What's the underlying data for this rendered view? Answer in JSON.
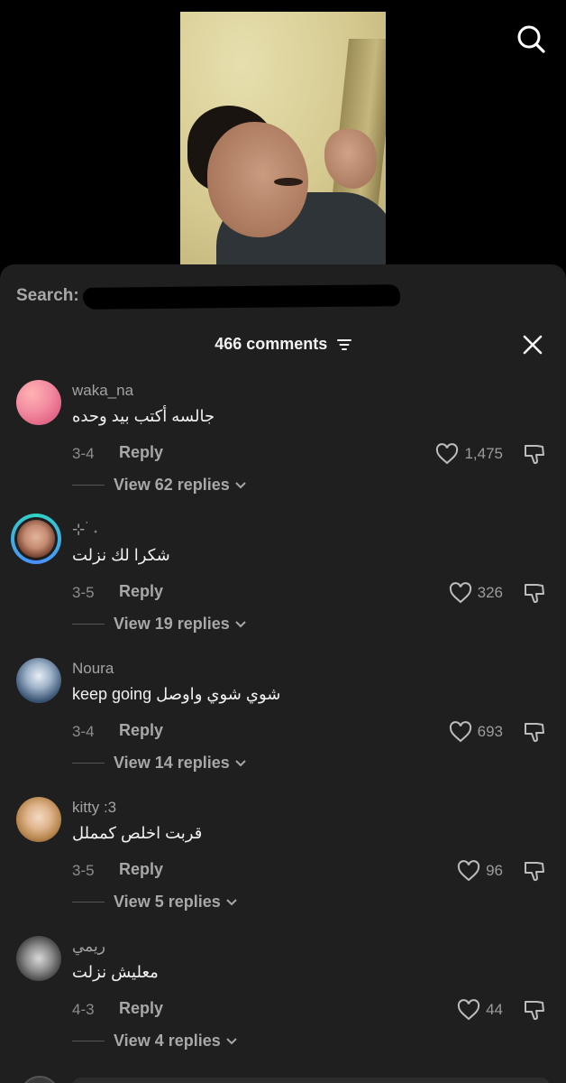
{
  "search": {
    "label": "Search:",
    "icon": "search-icon"
  },
  "comments_panel": {
    "count_label": "466 comments",
    "filter_icon": "filter-icon",
    "close_icon": "close-icon"
  },
  "comments": [
    {
      "username": "waka_na",
      "text": "جالسه أكتب بيد وحده",
      "date": "3-4",
      "reply_label": "Reply",
      "likes": "1,475",
      "replies_label": "View 62 replies",
      "avatar_style": "gradient-pink"
    },
    {
      "username": "⊹ ࣪ ˖",
      "text": "شكرا لك نزلت",
      "date": "3-5",
      "reply_label": "Reply",
      "likes": "326",
      "replies_label": "View 19 replies",
      "avatar_style": "story-ring"
    },
    {
      "username": "Noura",
      "text": "keep going شوي شوي واوصل",
      "date": "3-4",
      "reply_label": "Reply",
      "likes": "693",
      "replies_label": "View 14 replies",
      "avatar_style": "photo-blue"
    },
    {
      "username": "kitty :3",
      "text": "قربت اخلص كمملل",
      "date": "3-5",
      "reply_label": "Reply",
      "likes": "96",
      "replies_label": "View 5 replies",
      "avatar_style": "photo-blonde"
    },
    {
      "username": "ريمي",
      "text": "معليش نزلت",
      "date": "4-3",
      "reply_label": "Reply",
      "likes": "44",
      "replies_label": "View 4 replies",
      "avatar_style": "photo-gray"
    }
  ],
  "colors": {
    "sheet_background": "#1f1f1f",
    "screen_background": "#000000",
    "text_primary": "#f1f1f1",
    "text_secondary": "#a3a3a3",
    "story_ring": "#2fd4c4"
  }
}
